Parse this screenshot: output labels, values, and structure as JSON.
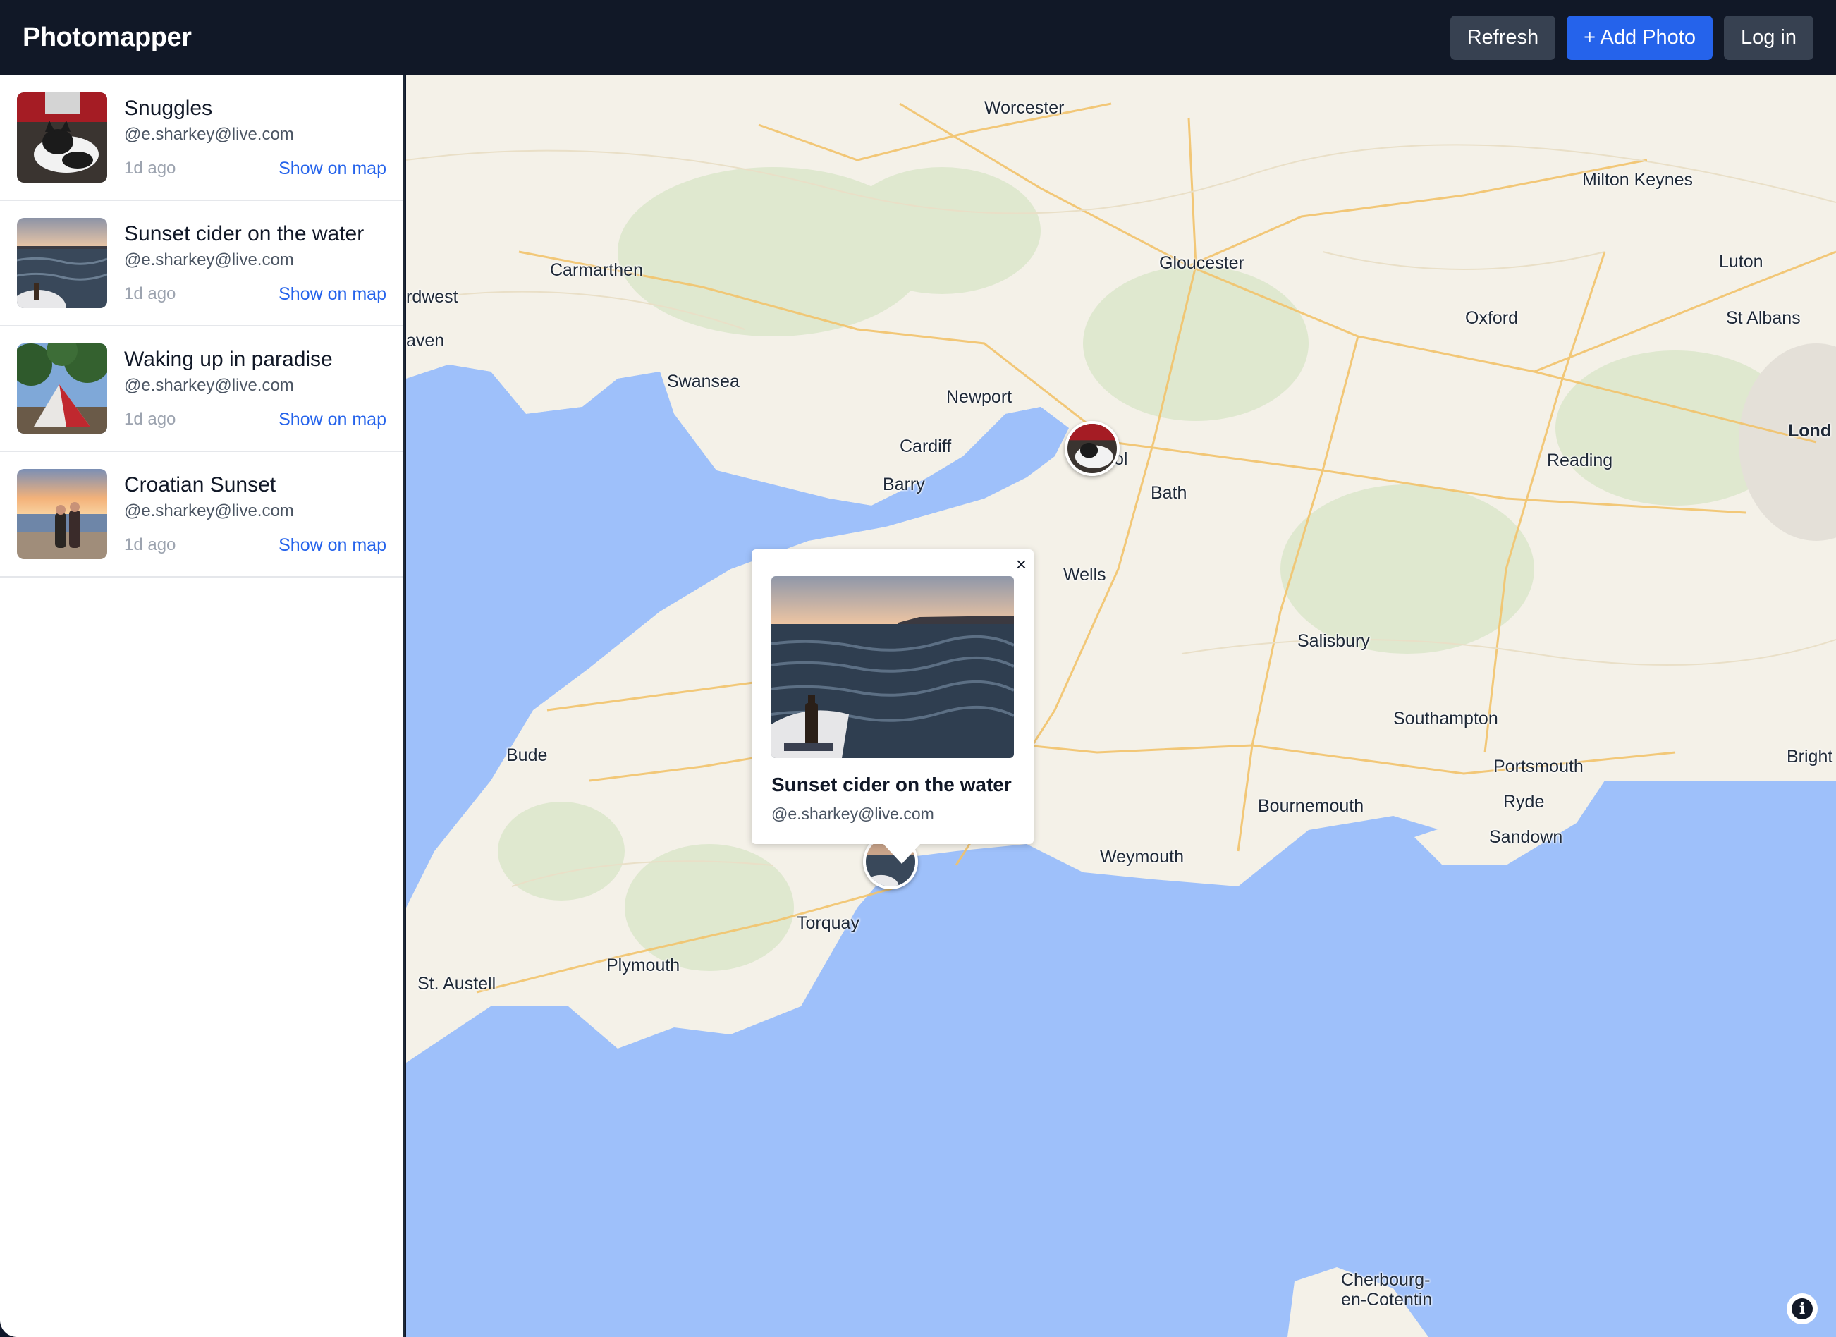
{
  "header": {
    "logo": "Photomapper",
    "refresh_label": "Refresh",
    "add_photo_label": "+ Add Photo",
    "login_label": "Log in"
  },
  "sidebar": {
    "items": [
      {
        "title": "Snuggles",
        "user": "@e.sharkey@live.com",
        "time": "1d ago",
        "link": "Show on map"
      },
      {
        "title": "Sunset cider on the water",
        "user": "@e.sharkey@live.com",
        "time": "1d ago",
        "link": "Show on map"
      },
      {
        "title": "Waking up in paradise",
        "user": "@e.sharkey@live.com",
        "time": "1d ago",
        "link": "Show on map"
      },
      {
        "title": "Croatian Sunset",
        "user": "@e.sharkey@live.com",
        "time": "1d ago",
        "link": "Show on map"
      }
    ]
  },
  "map": {
    "cities": [
      "Worcester",
      "Milton Keynes",
      "Gloucester",
      "Luton",
      "Carmarthen",
      "rdwest",
      "Oxford",
      "St Albans",
      "aven",
      "Swansea",
      "Newport",
      "Cardiff",
      "Barry",
      "ol",
      "Bath",
      "Reading",
      "Lond",
      "Wells",
      "Salisbury",
      "Southampton",
      "Portsmouth",
      "Bright",
      "Bude",
      "Bournemouth",
      "Ryde",
      "Sandown",
      "Weymouth",
      "Torquay",
      "Plymouth",
      "St. Austell",
      "Cherbourg-",
      "en-Cotentin"
    ],
    "popup": {
      "close": "×",
      "title": "Sunset cider on the water",
      "user": "@e.sharkey@live.com"
    },
    "info": "i"
  },
  "colors": {
    "header_bg": "#111827",
    "accent": "#2563eb",
    "sea": "#9ec0fa",
    "land": "#f6f3ea"
  }
}
